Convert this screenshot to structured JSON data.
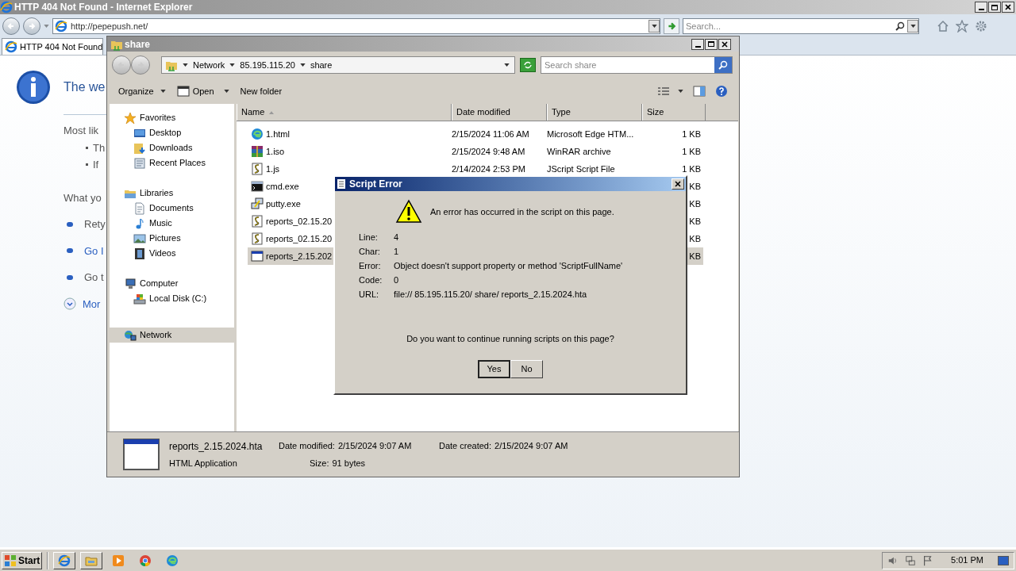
{
  "browser": {
    "title": "HTTP 404 Not Found - Internet Explorer",
    "address": "http://pepepush.net/",
    "search_placeholder": "Search...",
    "tabs": [
      {
        "label": "HTTP 404 Not Found",
        "selected": true
      }
    ],
    "page": {
      "heading": "The we",
      "intro": "Most lik",
      "bullets": [
        "Th",
        "If"
      ],
      "subheading": "What yo",
      "actions": [
        {
          "label": "Rety",
          "kind": "text"
        },
        {
          "label": "Go I",
          "kind": "link"
        },
        {
          "label": "Go t",
          "kind": "text"
        }
      ],
      "more": "Mor"
    }
  },
  "explorer": {
    "title": "share",
    "breadcrumb": [
      "Network",
      "85.195.115.20",
      "share"
    ],
    "search_placeholder": "Search share",
    "toolbar": [
      {
        "label": "Organize",
        "kind": "menu"
      },
      {
        "label": "Open",
        "kind": "split"
      },
      {
        "label": "New folder",
        "kind": "plain"
      }
    ],
    "nav": [
      {
        "label": "Favorites",
        "selected": false,
        "children": [
          {
            "label": "Desktop",
            "selected": false
          },
          {
            "label": "Downloads",
            "selected": false
          },
          {
            "label": "Recent Places",
            "selected": false
          }
        ]
      },
      {
        "label": "Libraries",
        "selected": false,
        "children": [
          {
            "label": "Documents",
            "selected": false
          },
          {
            "label": "Music",
            "selected": false
          },
          {
            "label": "Pictures",
            "selected": false
          },
          {
            "label": "Videos",
            "selected": false
          }
        ]
      },
      {
        "label": "Computer",
        "selected": false,
        "children": [
          {
            "label": "Local Disk (C:)",
            "selected": false
          }
        ]
      },
      {
        "label": "Network",
        "selected": true
      }
    ],
    "columns": [
      "Name",
      "Date modified",
      "Type",
      "Size"
    ],
    "files": [
      {
        "name": "1.html",
        "date": "2/15/2024 11:06 AM",
        "type": "Microsoft Edge HTM...",
        "size": "1 KB",
        "selected": false
      },
      {
        "name": "1.iso",
        "date": "2/15/2024 9:48 AM",
        "type": "WinRAR archive",
        "size": "1 KB",
        "selected": false
      },
      {
        "name": "1.js",
        "date": "2/14/2024 2:53 PM",
        "type": "JScript Script File",
        "size": "1 KB",
        "selected": false
      },
      {
        "name": "cmd.exe",
        "size": "KB",
        "selected": false
      },
      {
        "name": "putty.exe",
        "size": "KB",
        "selected": false
      },
      {
        "name": "reports_02.15.20",
        "size": "KB",
        "selected": false
      },
      {
        "name": "reports_02.15.20",
        "size": "KB",
        "selected": false
      },
      {
        "name": "reports_2.15.202",
        "size": "KB",
        "selected": true
      }
    ],
    "details": {
      "name": "reports_2.15.2024.hta",
      "type": "HTML Application",
      "fields": [
        {
          "label": "Date modified:",
          "value": "2/15/2024 9:07 AM"
        },
        {
          "label": "Size:",
          "value": "91 bytes"
        },
        {
          "label": "Date created:",
          "value": "2/15/2024 9:07 AM"
        }
      ]
    }
  },
  "dialog": {
    "title": "Script Error",
    "message": "An error has occurred in the script on this page.",
    "fields": [
      {
        "label": "Line:",
        "value": "4"
      },
      {
        "label": "Char:",
        "value": "1"
      },
      {
        "label": "Error:",
        "value": "Object doesn't support property or method 'ScriptFullName'"
      },
      {
        "label": "Code:",
        "value": "0"
      },
      {
        "label": "URL:",
        "value": "file:// 85.195.115.20/ share/ reports_2.15.2024.hta"
      }
    ],
    "question": "Do you want to continue running scripts on this page?",
    "buttons": [
      {
        "label": "Yes",
        "default": true
      },
      {
        "label": "No",
        "default": false
      }
    ]
  },
  "taskbar": {
    "start": "Start",
    "time": "5:01 PM"
  }
}
